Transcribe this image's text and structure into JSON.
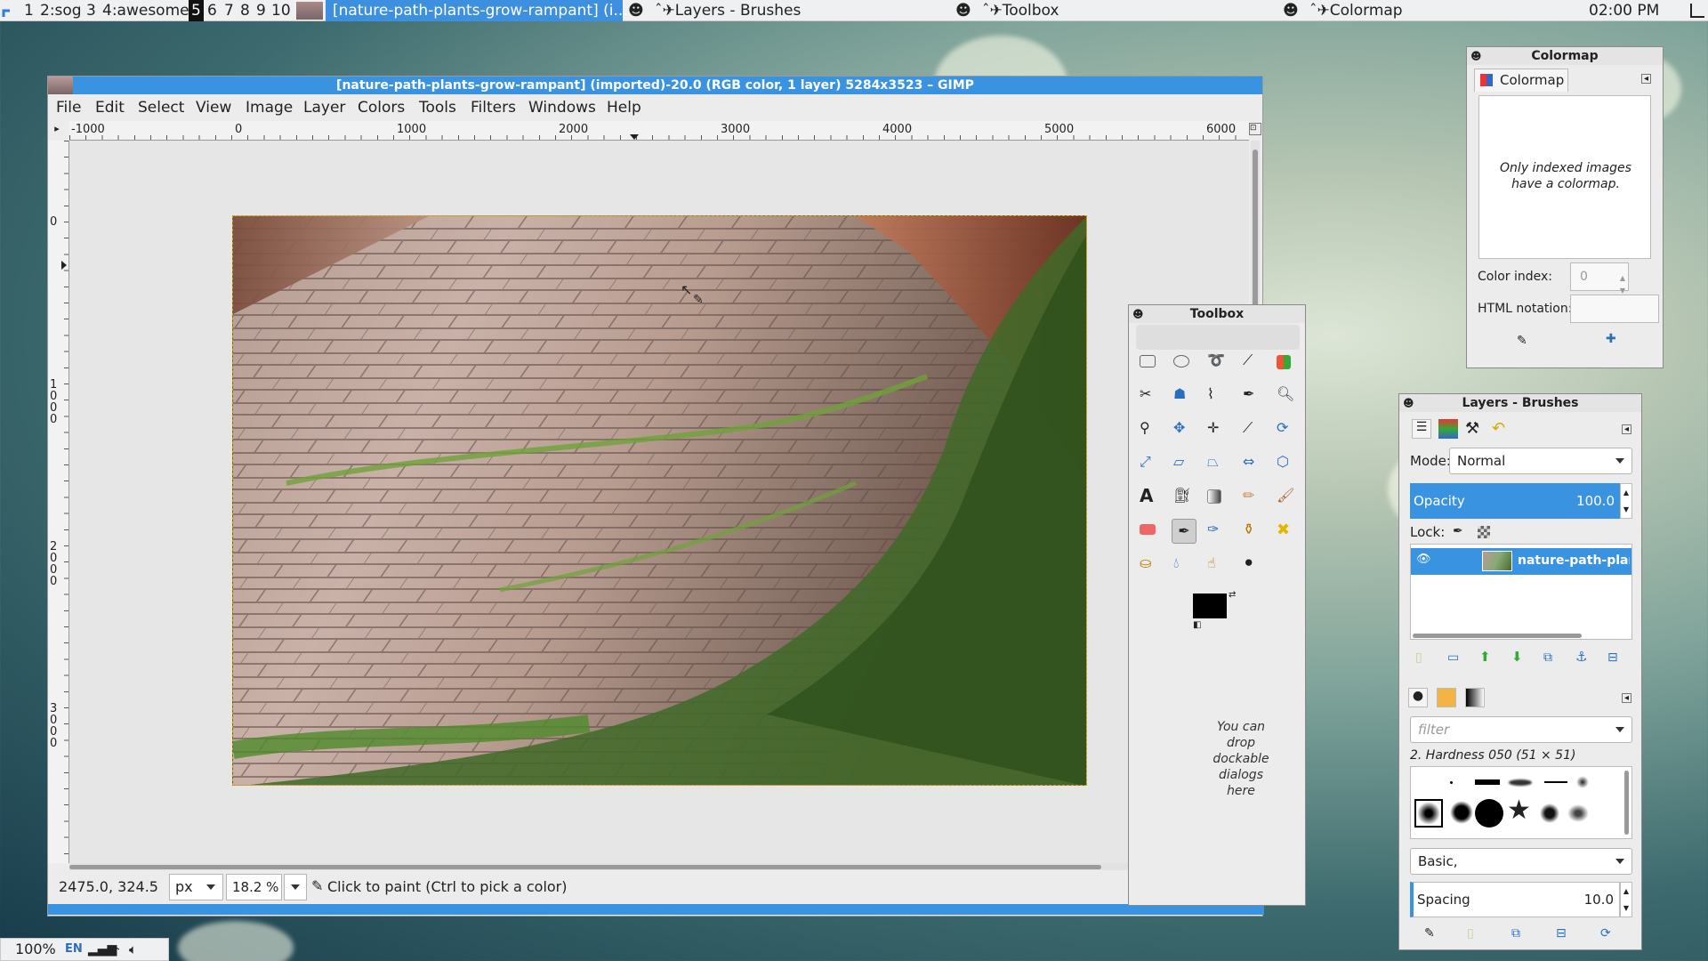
{
  "topbar": {
    "tags": [
      "1",
      "2:sog",
      "3",
      "4:awesome",
      "5",
      "6",
      "7",
      "8",
      "9",
      "10"
    ],
    "active_tag": "5",
    "tasks": [
      {
        "label": "[nature-path-plants-grow-rampant] (i...",
        "active": true
      },
      {
        "label": "ˆ✈Layers - Brushes",
        "active": false
      },
      {
        "label": "ˆ✈Toolbox",
        "active": false
      },
      {
        "label": "ˆ✈Colormap",
        "active": false
      }
    ],
    "clock": "02:00 PM"
  },
  "main_window": {
    "title": "[nature-path-plants-grow-rampant] (imported)-20.0 (RGB color, 1 layer) 5284x3523 – GIMP",
    "menu": [
      "File",
      "Edit",
      "Select",
      "View",
      "Image",
      "Layer",
      "Colors",
      "Tools",
      "Filters",
      "Windows",
      "Help"
    ],
    "ruler_top": [
      "-1000",
      "0",
      "1000",
      "2000",
      "3000",
      "4000",
      "5000",
      "6000"
    ],
    "ruler_left": [
      "0",
      "1\n0\n0\n0",
      "2\n0\n0\n0",
      "3\n0\n0\n0"
    ],
    "status": {
      "coords": "2475.0, 324.5",
      "unit": "px",
      "zoom": "18.2 %",
      "message": "Click to paint (Ctrl to pick a color)"
    }
  },
  "toolbox": {
    "title": "Toolbox",
    "drop_hint": "You can drop dockable dialogs here",
    "fg_color": "#000000",
    "bg_color": "#ffffff"
  },
  "colormap": {
    "title": "Colormap",
    "tab": "Colormap",
    "message": "Only indexed images have a colormap.",
    "color_index_label": "Color index:",
    "color_index_value": "0",
    "html_label": "HTML notation:",
    "html_value": ""
  },
  "layers": {
    "title": "Layers - Brushes",
    "mode_label": "Mode:",
    "mode_value": "Normal",
    "opacity_label": "Opacity",
    "opacity_value": "100.0",
    "lock_label": "Lock:",
    "layer_name": "nature-path-plants"
  },
  "brushes": {
    "filter_placeholder": "filter",
    "selected": "2. Hardness 050 (51 × 51)",
    "tag": "Basic,",
    "spacing_label": "Spacing",
    "spacing_value": "10.0"
  },
  "tray": {
    "percent": "100%",
    "lang": "EN"
  },
  "colors": {
    "accent": "#3a93e0",
    "dock_bg": "#ececec"
  }
}
